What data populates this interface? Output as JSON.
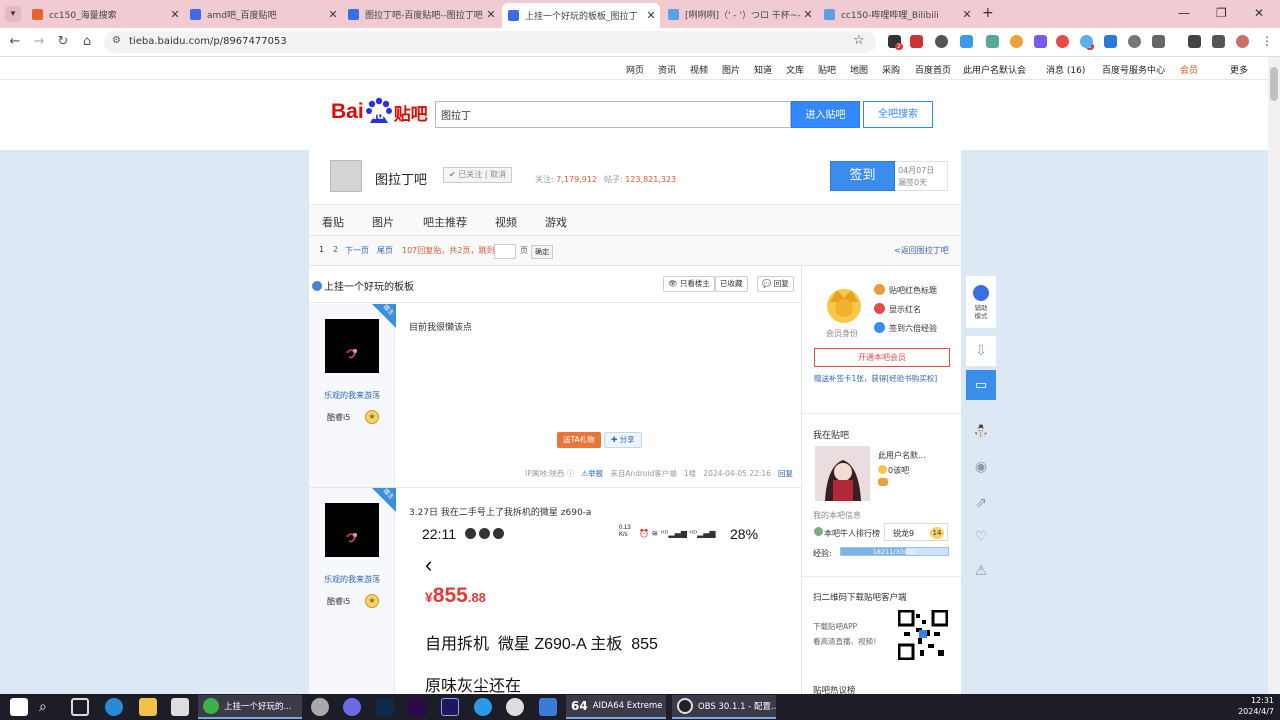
{
  "browser": {
    "tabs": [
      {
        "title": "cc150_海量搜索",
        "color": "#e8642a"
      },
      {
        "title": "amd吧_百度贴吧",
        "color": "#3a6ee8"
      },
      {
        "title": "图拉丁吧-百度贴吧--图拉丁吧",
        "color": "#3a6ee8"
      },
      {
        "title": "上挂一个好玩的板板_图拉丁",
        "color": "#3a6ee8"
      },
      {
        "title": "[咧咧咧]（' - '）つロ 干杯~-bi",
        "color": "#5aa0e8"
      },
      {
        "title": "cc150-哔哩哔哩_Bilibili",
        "color": "#5aa0e8"
      }
    ],
    "new_tab": "+",
    "url": "tieba.baidu.com/p/8967477053",
    "ext_badges": [
      "2",
      "2"
    ]
  },
  "topnav": {
    "links": [
      "网页",
      "资讯",
      "视频",
      "图片",
      "知道",
      "文库",
      "贴吧",
      "地图",
      "采购",
      "百度首页"
    ],
    "user": "此用户名默认会",
    "messages": "消息 (16)",
    "biz": "百度号服务中心",
    "vip": "会员",
    "more": "更多"
  },
  "header": {
    "logo_text": "Bai",
    "logo_du": "du",
    "logo_tieba": "贴吧",
    "search_value": "图拉丁",
    "enter_btn": "进入贴吧",
    "all_btn": "全吧搜索"
  },
  "forum": {
    "name": "图拉丁吧",
    "followed": "已关注 | 取消",
    "follow_label": "关注:",
    "follow_count": "7,179,912",
    "posts_label": "帖子:",
    "posts_count": "123,821,323",
    "sign_btn": "签到",
    "sign_date": "04月07日",
    "sign_streak": "漏签0天",
    "tabs": [
      "看贴",
      "图片",
      "吧主推荐",
      "视频",
      "游戏"
    ]
  },
  "pager": {
    "p1": "1",
    "p2": "2",
    "next": "下一页",
    "last": "尾页",
    "info": "107回复贴，共2页，跳到",
    "page_unit": "页",
    "go": "确定",
    "back": "<返回图拉丁吧"
  },
  "post": {
    "title": "上挂一个好玩的板板",
    "btn_lz": "只看楼主",
    "btn_fav": "已收藏",
    "btn_reply": "回复",
    "author": "乐观的我来游荡",
    "level": "酷睿i5",
    "corner": "楼主",
    "floor1_text": "目前我很懒该点",
    "gift_btn": "送TA礼物",
    "share_btn": "分享",
    "ip": "IP属地:陕西",
    "report": "举报",
    "source": "来自Android客户端",
    "floor": "1楼",
    "time": "2024-04-05 22:16",
    "reply": "回复",
    "floor2_text": "3.27日 我在二手号上了我拆机的微星 z690-a",
    "phone_time": "22:11",
    "phone_net": "0.13 K/s",
    "phone_battery": "28%",
    "price_symbol": "¥",
    "price_main": "855",
    "price_dec": ".88",
    "listing_title": "自用拆机  微星 Z690-A 主板  855",
    "listing_line2": "原味灰尘还在"
  },
  "sidebar": {
    "perks": [
      "贴吧红色标题",
      "显示红名",
      "签到六倍经验"
    ],
    "crown_label": "会员身份",
    "renew_btn": "开通本吧会员",
    "gift_note": "赠送补签卡1张，获得[经验书购买权]",
    "my_tieba": "我在贴吧",
    "user_name": "此用户名默...",
    "user_lvl": "0该吧",
    "info_link": "我的本吧信息",
    "rank_label": "本吧牛人排行榜",
    "rank_value": "锐龙9",
    "rank_num": "14",
    "xp_label": "经验:",
    "xp_value": "18211/30000",
    "xp_fraction": 0.607,
    "qr_title": "扫二维码下载贴吧客户端",
    "qr_line1": "下载贴吧APP",
    "qr_line2": "看高清直播、视频！",
    "bottom_title": "贴吧热议榜"
  },
  "floatbar": {
    "assist": "辅助模式"
  },
  "taskbar": {
    "apps": [
      {
        "title": "上挂一个好玩的..."
      },
      {
        "title": "AIDA64 Extreme ..."
      },
      {
        "title": "OBS 30.1.1 - 配置..."
      }
    ],
    "time": "12:31",
    "date": "2024/4/7"
  }
}
